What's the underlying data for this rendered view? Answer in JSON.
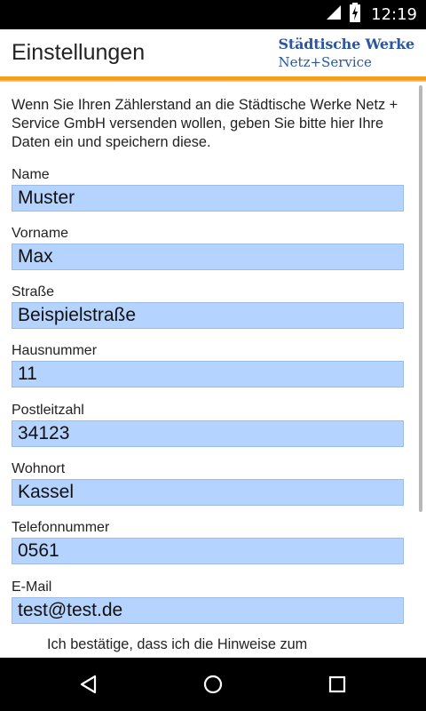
{
  "status_bar": {
    "time": "12:19"
  },
  "app_bar": {
    "title": "Einstellungen",
    "brand_line1": "Städtische Werke",
    "brand_line2": "Netz+Service"
  },
  "form": {
    "intro": "Wenn Sie Ihren Zählerstand an die Städtische Werke Netz + Service GmbH versenden wollen, geben Sie bitte hier Ihre Daten ein und speichern diese.",
    "fields": [
      {
        "label": "Name",
        "value": "Muster"
      },
      {
        "label": "Vorname",
        "value": "Max"
      },
      {
        "label": "Straße",
        "value": "Beispielstraße"
      },
      {
        "label": "Hausnummer",
        "value": "11"
      },
      {
        "label": "Postleitzahl",
        "value": "34123"
      },
      {
        "label": "Wohnort",
        "value": "Kassel"
      },
      {
        "label": "Telefonnummer",
        "value": "0561"
      },
      {
        "label": "E-Mail",
        "value": "test@test.de"
      }
    ],
    "confirm_text": "Ich bestätige, dass ich die Hinweise zum"
  },
  "colors": {
    "brand_blue": "#2b56a0",
    "accent_orange": "#f7a11a",
    "input_bg": "#b5d3ff"
  },
  "nav_bar": {
    "icons": [
      "back-icon",
      "home-icon",
      "recents-icon"
    ]
  }
}
